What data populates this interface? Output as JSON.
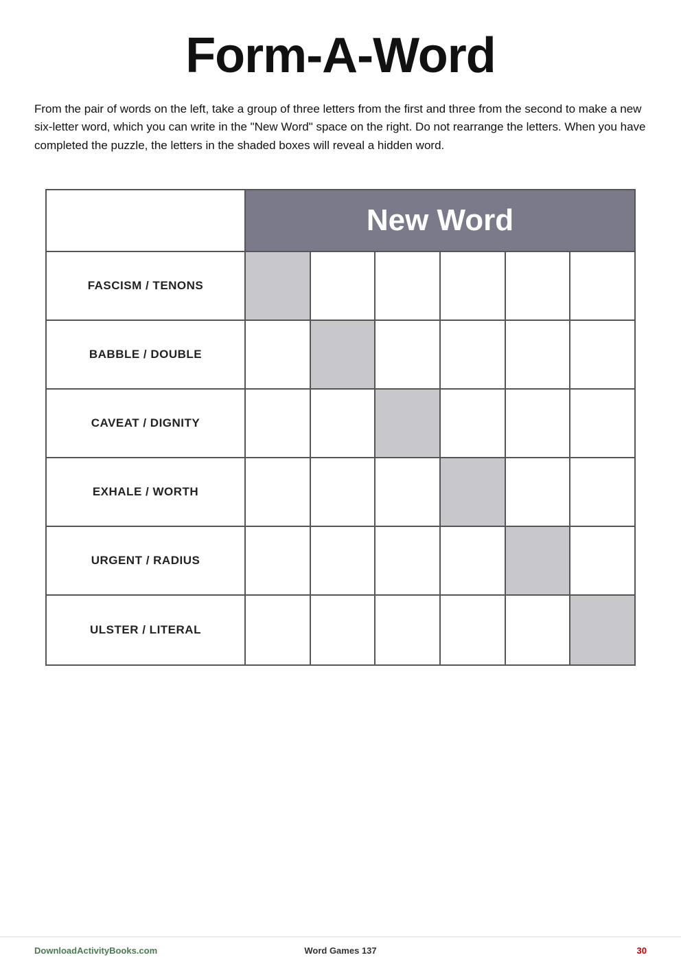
{
  "title": "Form-A-Word",
  "instructions": "From the pair of words on the left, take a group of three letters from the first and three from the second to make a new six-letter word, which you can write in the \"New Word\" space on the right. Do not rearrange the letters. When you have completed the puzzle, the letters in the shaded boxes will reveal a hidden word.",
  "header": {
    "new_word_label": "New Word"
  },
  "rows": [
    {
      "label": "FASCISM / TENONS",
      "shaded": [
        0
      ]
    },
    {
      "label": "BABBLE / DOUBLE",
      "shaded": [
        1
      ]
    },
    {
      "label": "CAVEAT / DIGNITY",
      "shaded": [
        2
      ]
    },
    {
      "label": "EXHALE / WORTH",
      "shaded": [
        3
      ]
    },
    {
      "label": "URGENT / RADIUS",
      "shaded": [
        4
      ]
    },
    {
      "label": "ULSTER / LITERAL",
      "shaded": [
        5
      ]
    }
  ],
  "footer": {
    "left": "DownloadActivityBooks.com",
    "center": "Word Games 137",
    "right": "30"
  }
}
